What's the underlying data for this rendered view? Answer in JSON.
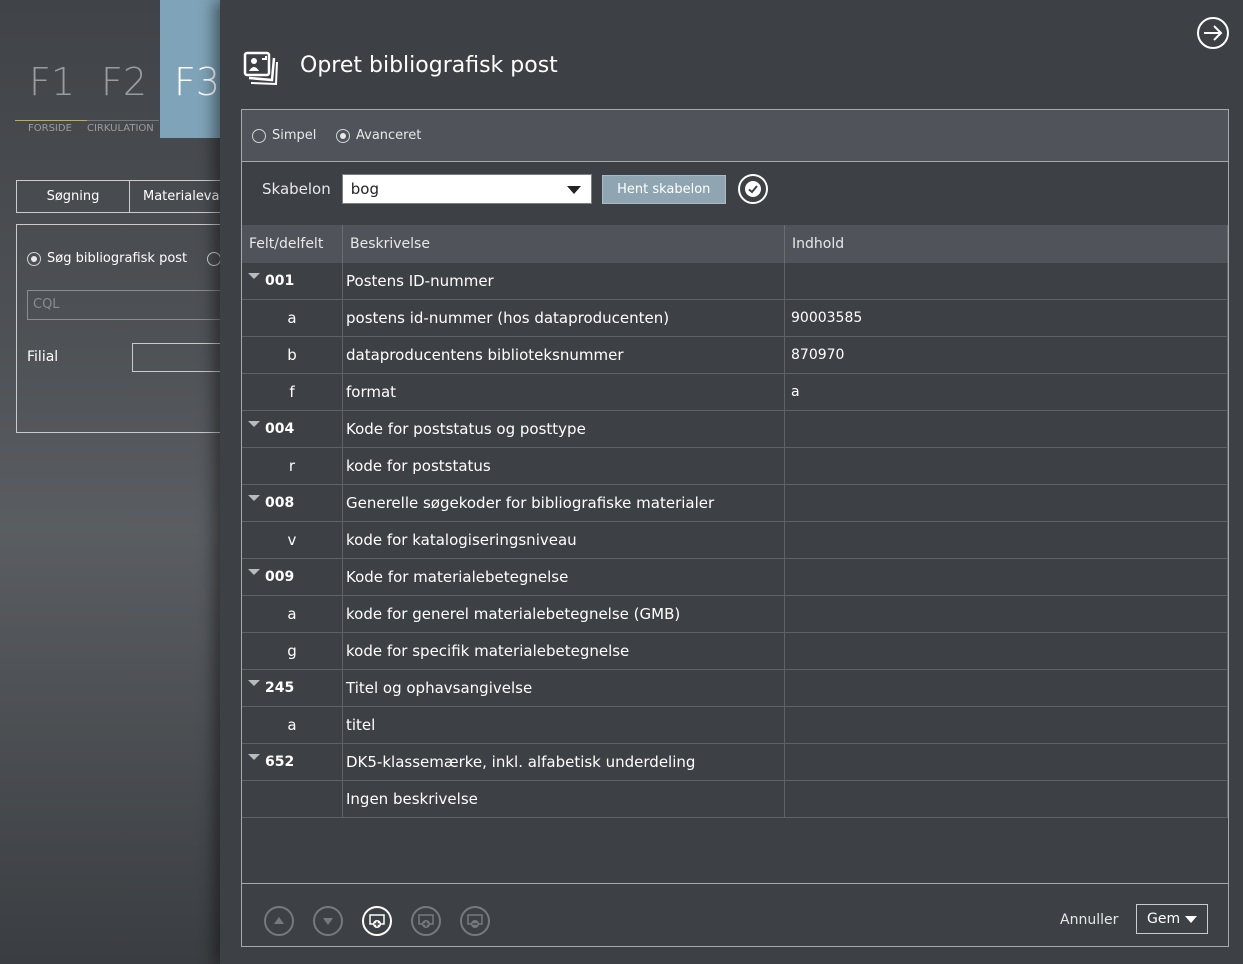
{
  "background_app": {
    "fkeys": [
      {
        "key": "F1",
        "label": "FORSIDE"
      },
      {
        "key": "F2",
        "label": "CIRKULATION"
      },
      {
        "key": "F3",
        "label": ""
      }
    ],
    "tabs": [
      "Søgning",
      "Materialeval"
    ],
    "search_radio_label": "Søg bibliografisk post",
    "cql_placeholder": "CQL",
    "filial_label": "Filial"
  },
  "modal": {
    "title": "Opret bibliografisk post",
    "mode_options": [
      {
        "label": "Simpel",
        "selected": false
      },
      {
        "label": "Avanceret",
        "selected": true
      }
    ],
    "template_label": "Skabelon",
    "template_value": "bog",
    "fetch_template_label": "Hent skabelon",
    "columns": [
      "Felt/delfelt",
      "Beskrivelse",
      "Indhold"
    ],
    "rows": [
      {
        "code": "001",
        "type": "field",
        "desc": "Postens ID-nummer",
        "content": ""
      },
      {
        "code": "a",
        "type": "sub",
        "desc": "postens id-nummer (hos dataproducenten)",
        "content": "90003585"
      },
      {
        "code": "b",
        "type": "sub",
        "desc": "dataproducentens biblioteksnummer",
        "content": "870970"
      },
      {
        "code": "f",
        "type": "sub",
        "desc": "format",
        "content": "a"
      },
      {
        "code": "004",
        "type": "field",
        "desc": "Kode for poststatus og posttype",
        "content": ""
      },
      {
        "code": "r",
        "type": "sub",
        "desc": "kode for poststatus",
        "content": ""
      },
      {
        "code": "008",
        "type": "field",
        "desc": "Generelle søgekoder for bibliografiske materialer",
        "content": ""
      },
      {
        "code": "v",
        "type": "sub",
        "desc": "kode for katalogiseringsniveau",
        "content": ""
      },
      {
        "code": "009",
        "type": "field",
        "desc": "Kode for materialebetegnelse",
        "content": ""
      },
      {
        "code": "a",
        "type": "sub",
        "desc": "kode for generel materialebetegnelse (GMB)",
        "content": ""
      },
      {
        "code": "g",
        "type": "sub",
        "desc": "kode for specifik materialebetegnelse",
        "content": ""
      },
      {
        "code": "245",
        "type": "field",
        "desc": "Titel og ophavsangivelse",
        "content": ""
      },
      {
        "code": "a",
        "type": "sub",
        "desc": "titel",
        "content": ""
      },
      {
        "code": "652",
        "type": "field",
        "desc": "DK5-klassemærke, inkl. alfabetisk underdeling",
        "content": ""
      },
      {
        "code": "",
        "type": "sub",
        "desc": "Ingen beskrivelse",
        "content": ""
      }
    ],
    "cancel_label": "Annuller",
    "save_label": "Gem",
    "icons": [
      "exit-icon",
      "stack-icon",
      "check-icon",
      "move-up-icon",
      "move-down-icon",
      "add-field-icon",
      "add-subfield-icon",
      "remove-field-icon"
    ]
  }
}
